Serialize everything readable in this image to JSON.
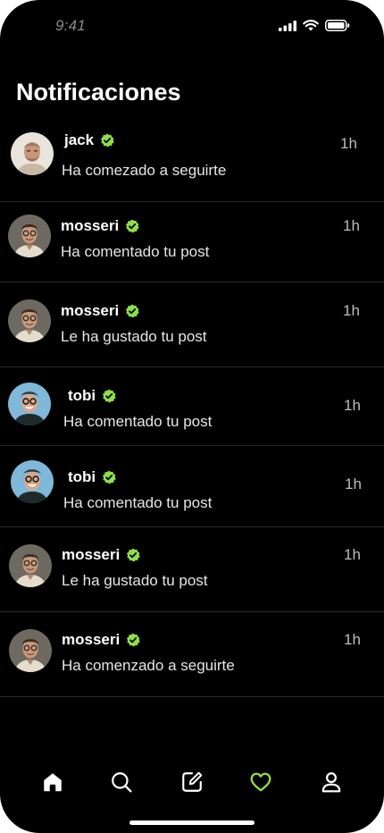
{
  "status_bar": {
    "time": "9:41"
  },
  "header": {
    "title": "Notificaciones"
  },
  "colors": {
    "background": "#000000",
    "accent": "#8ee04a",
    "divider": "#2a2a2a",
    "text": "#ffffff",
    "muted": "#bdbdbd"
  },
  "notifications": [
    {
      "username": "jack",
      "verified": true,
      "text": "Ha comezado a seguirte",
      "time": "1h",
      "avatar": "jack-avatar"
    },
    {
      "username": "mosseri",
      "verified": true,
      "text": "Ha comentado tu post",
      "time": "1h",
      "avatar": "mosseri-avatar"
    },
    {
      "username": "mosseri",
      "verified": true,
      "text": "Le ha gustado tu post",
      "time": "1h",
      "avatar": "mosseri-avatar"
    },
    {
      "username": "tobi",
      "verified": true,
      "text": "Ha comentado tu post",
      "time": "1h",
      "avatar": "tobi-avatar"
    },
    {
      "username": "tobi",
      "verified": true,
      "text": "Ha comentado tu post",
      "time": "1h",
      "avatar": "tobi-avatar"
    },
    {
      "username": "mosseri",
      "verified": true,
      "text": "Le ha gustado tu post",
      "time": "1h",
      "avatar": "mosseri-avatar"
    },
    {
      "username": "mosseri",
      "verified": true,
      "text": "Ha comenzado a seguirte",
      "time": "1h",
      "avatar": "mosseri-avatar"
    }
  ],
  "tab_bar": {
    "items": [
      {
        "name": "home",
        "icon": "home-icon",
        "active": false
      },
      {
        "name": "search",
        "icon": "search-icon",
        "active": false
      },
      {
        "name": "compose",
        "icon": "compose-icon",
        "active": false
      },
      {
        "name": "activity",
        "icon": "heart-icon",
        "active": true
      },
      {
        "name": "profile",
        "icon": "profile-icon",
        "active": false
      }
    ]
  }
}
